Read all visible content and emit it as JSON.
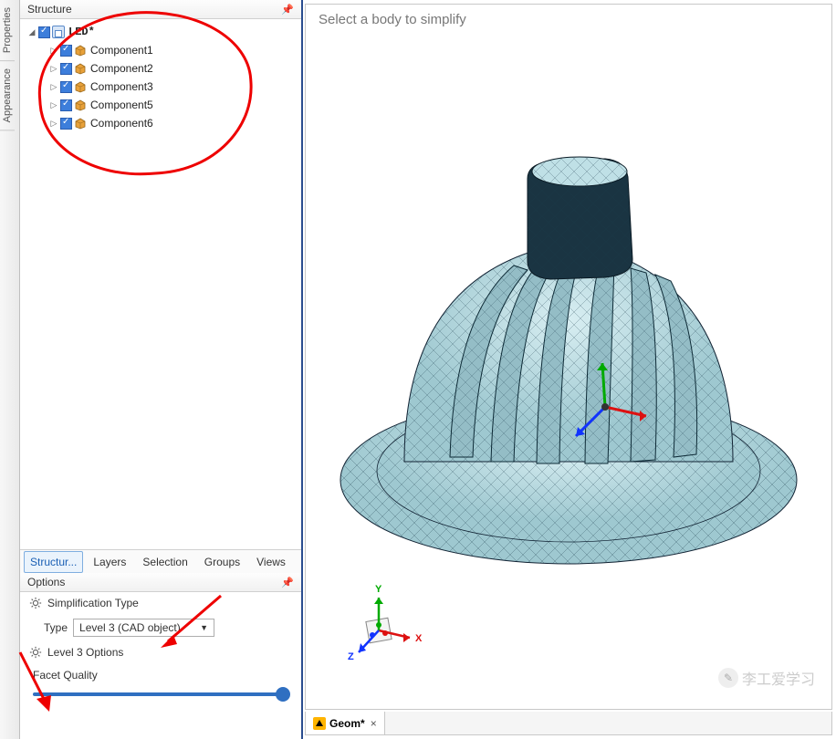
{
  "vtabs": {
    "properties": "Properties",
    "appearance": "Appearance"
  },
  "structure": {
    "title": "Structure",
    "root": "LED*",
    "children": [
      {
        "label": "Component1"
      },
      {
        "label": "Component2"
      },
      {
        "label": "Component3"
      },
      {
        "label": "Component5"
      },
      {
        "label": "Component6"
      }
    ]
  },
  "panelTabs": {
    "structure": "Structur...",
    "layers": "Layers",
    "selection": "Selection",
    "groups": "Groups",
    "views": "Views"
  },
  "options": {
    "title": "Options",
    "simpType": "Simplification Type",
    "typeLabel": "Type",
    "typeValue": "Level 3 (CAD object)",
    "level3": "Level 3 Options",
    "facetQuality": "Facet Quality"
  },
  "viewport": {
    "message": "Select a body to simplify",
    "triad": {
      "x": "X",
      "y": "Y",
      "z": "Z"
    }
  },
  "watermark": "李工爱学习",
  "docTab": "Geom*"
}
